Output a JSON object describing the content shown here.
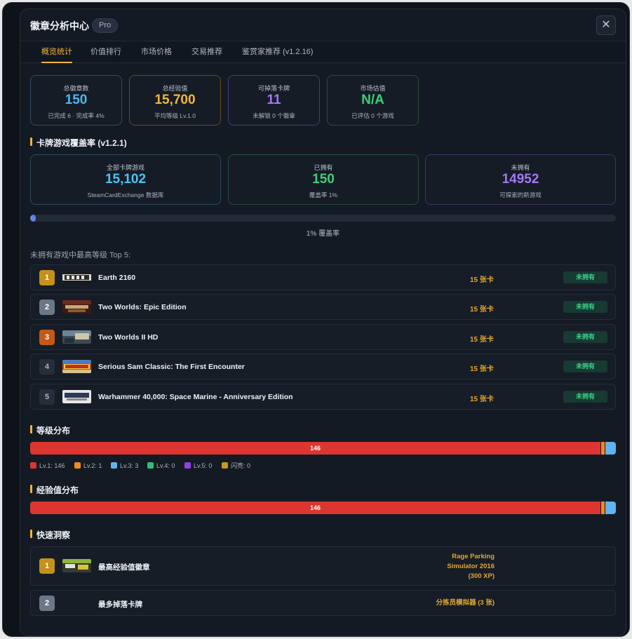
{
  "window": {
    "title": "徽章分析中心",
    "badge": "Pro",
    "close_icon": "close-icon"
  },
  "tabs": [
    {
      "label": "概览统计",
      "active": true
    },
    {
      "label": "价值排行",
      "active": false
    },
    {
      "label": "市场价格",
      "active": false
    },
    {
      "label": "交易推荐",
      "active": false
    },
    {
      "label": "鉴赏家推荐 (v1.2.16)",
      "active": false
    }
  ],
  "stats": [
    {
      "label": "总徽章数",
      "value": "150",
      "sub": "已完成 6 · 完成率 4%",
      "color": "#4cb8f0",
      "border": "#2e4a63"
    },
    {
      "label": "总经验值",
      "value": "15,700",
      "sub": "平均等级 Lv.1.0",
      "color": "#f4b63a",
      "border": "#6b4a1c"
    },
    {
      "label": "可掉落卡牌",
      "value": "11",
      "sub": "未解锁 0 个徽章",
      "color": "#a478f5",
      "border": "#4b3a72"
    },
    {
      "label": "市场估值",
      "value": "N/A",
      "sub": "已评估 0 个游戏",
      "color": "#3fce79",
      "border": "#235038"
    }
  ],
  "coverage": {
    "title": "卡牌游戏覆盖率 (v1.2.1)",
    "cards": [
      {
        "label": "全部卡牌游戏",
        "value": "15,102",
        "sub": "SteamCardExchange 数据库",
        "color": "#4cc4f2",
        "border": "#2a4b5e"
      },
      {
        "label": "已拥有",
        "value": "150",
        "sub": "覆盖率 1%",
        "color": "#3fce79",
        "border": "#244d38"
      },
      {
        "label": "未拥有",
        "value": "14952",
        "sub": "可探索的新游戏",
        "color": "#a478f5",
        "border": "#3f3466"
      }
    ],
    "progress_percent": 1,
    "progress_label": "1% 覆盖率",
    "top_heading": "未拥有游戏中最高等级 Top 5:",
    "top_games": [
      {
        "rank": "1",
        "name": "Earth 2160",
        "cards": "15 张卡",
        "status": "未拥有",
        "rank_bg": "#c4911d",
        "rank_fg": "#fff"
      },
      {
        "rank": "2",
        "name": "Two Worlds: Epic Edition",
        "cards": "15 张卡",
        "status": "未拥有",
        "rank_bg": "#6c7787",
        "rank_fg": "#fff"
      },
      {
        "rank": "3",
        "name": "Two Worlds II HD",
        "cards": "15 张卡",
        "status": "未拥有",
        "rank_bg": "#c25a15",
        "rank_fg": "#fff"
      },
      {
        "rank": "4",
        "name": "Serious Sam Classic: The First Encounter",
        "cards": "15 张卡",
        "status": "未拥有",
        "rank_bg": "#262e3b",
        "rank_fg": "#aab3c0"
      },
      {
        "rank": "5",
        "name": "Warhammer 40,000: Space Marine - Anniversary Edition",
        "cards": "15 张卡",
        "status": "未拥有",
        "rank_bg": "#262e3b",
        "rank_fg": "#aab3c0"
      }
    ]
  },
  "level_distribution": {
    "title": "等级分布",
    "segments": [
      {
        "level": "Lv.1",
        "count": 146,
        "color": "#dd3630",
        "label": "146"
      },
      {
        "level": "Lv.2",
        "count": 1,
        "color": "#f08a1c",
        "label": ""
      },
      {
        "level": "Lv.3",
        "count": 3,
        "color": "#5fb3f0",
        "label": ""
      }
    ],
    "legend": [
      {
        "text": "Lv.1: 146",
        "color": "#dd3630"
      },
      {
        "text": "Lv.2: 1",
        "color": "#f08a1c"
      },
      {
        "text": "Lv.3: 3",
        "color": "#5fb3f0"
      },
      {
        "text": "Lv.4: 0",
        "color": "#2fbf7a"
      },
      {
        "text": "Lv.5: 0",
        "color": "#9340e8"
      },
      {
        "text": "闪亮: 0",
        "color": "#c49a1d"
      }
    ]
  },
  "xp_distribution": {
    "title": "经验值分布",
    "segments": [
      {
        "count": 146,
        "color": "#dd3630",
        "label": "146"
      },
      {
        "count": 1,
        "color": "#f08a1c",
        "label": ""
      },
      {
        "count": 3,
        "color": "#5fb3f0",
        "label": ""
      }
    ]
  },
  "insights": {
    "title": "快速洞察",
    "items": [
      {
        "rank": "1",
        "label": "最高经验值徽章",
        "value_lines": [
          "Rage Parking",
          "Simulator 2016",
          "(300 XP)"
        ],
        "rank_bg": "#c4911d"
      },
      {
        "rank": "2",
        "label": "最多掉落卡牌",
        "value_lines": [
          "分拣员模拟器 (3 张)"
        ],
        "rank_bg": "#6c7787"
      }
    ]
  }
}
